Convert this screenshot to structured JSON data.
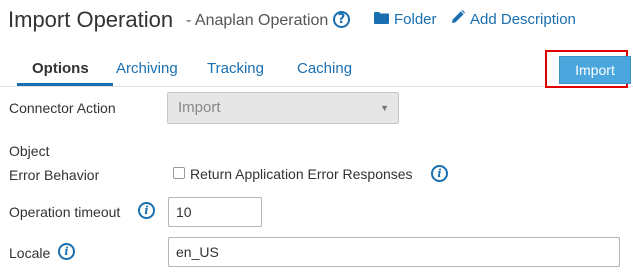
{
  "header": {
    "title": "Import Operation",
    "subtitle": "- Anaplan Operation",
    "help_icon": "question-circle-icon",
    "folder_link": "Folder",
    "folder_icon": "folder-icon",
    "description_link": "Add Description",
    "description_icon": "pencil-icon"
  },
  "tabs": [
    {
      "label": "Options",
      "active": true
    },
    {
      "label": "Archiving",
      "active": false
    },
    {
      "label": "Tracking",
      "active": false
    },
    {
      "label": "Caching",
      "active": false
    }
  ],
  "actions": {
    "import_label": "Import",
    "accent_color": "#4aa6dd",
    "highlight_color": "#e00000"
  },
  "form": {
    "connector_action": {
      "label": "Connector Action",
      "value": "Import"
    },
    "object": {
      "label": "Object"
    },
    "error_behavior": {
      "label": "Error Behavior",
      "checkbox_label": "Return Application Error Responses",
      "checked": false
    },
    "operation_timeout": {
      "label": "Operation timeout",
      "value": "10"
    },
    "locale": {
      "label": "Locale",
      "value": "en_US"
    }
  },
  "colors": {
    "link": "#1a6fb0",
    "text": "#333333"
  }
}
